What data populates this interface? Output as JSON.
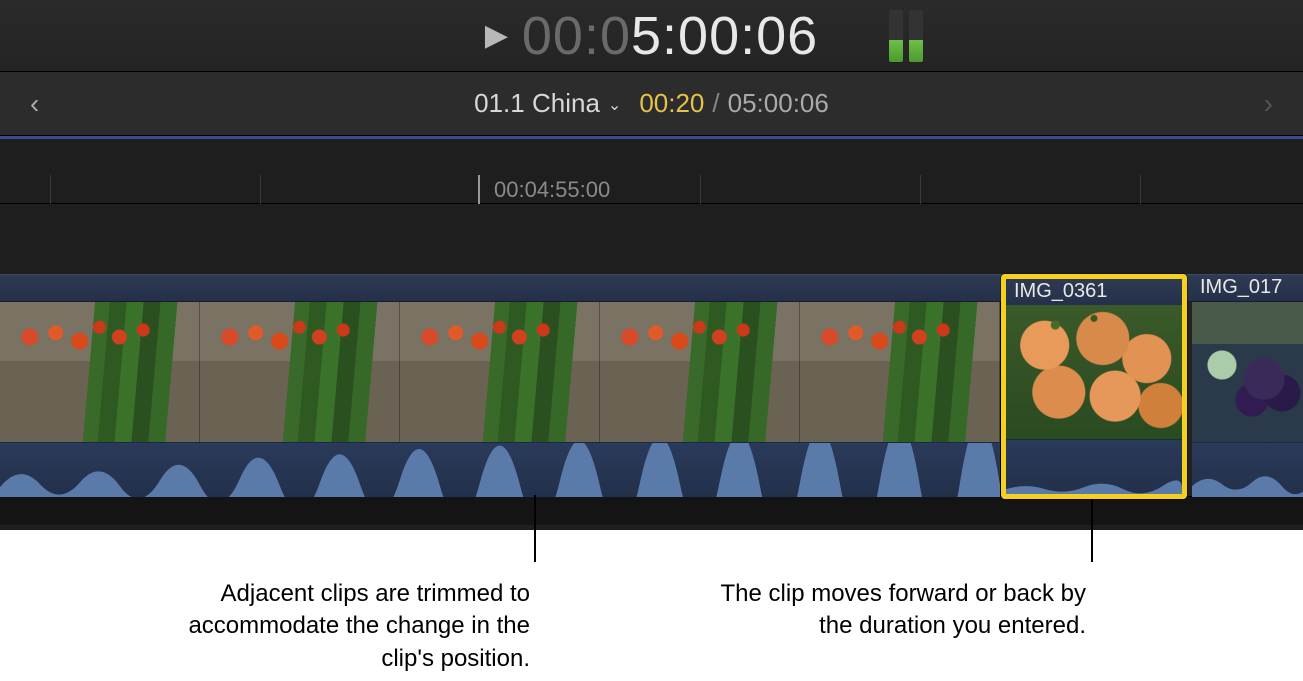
{
  "timecode": {
    "dim_prefix": "00:0",
    "bright_suffix": "5:00:06"
  },
  "project": {
    "name": "01.1 China",
    "current_time": "00:20",
    "separator": "/",
    "total_time": "05:00:06"
  },
  "ruler": {
    "playhead_label": "00:04:55:00"
  },
  "clips": {
    "selected_name": "IMG_0361",
    "next_name": "IMG_017"
  },
  "callouts": {
    "left": "Adjacent clips are trimmed to accommodate the change in the clip's position.",
    "right": "The clip moves forward or back by the duration you entered."
  },
  "colors": {
    "selection": "#f5d020",
    "accent_time": "#e6c24a"
  }
}
